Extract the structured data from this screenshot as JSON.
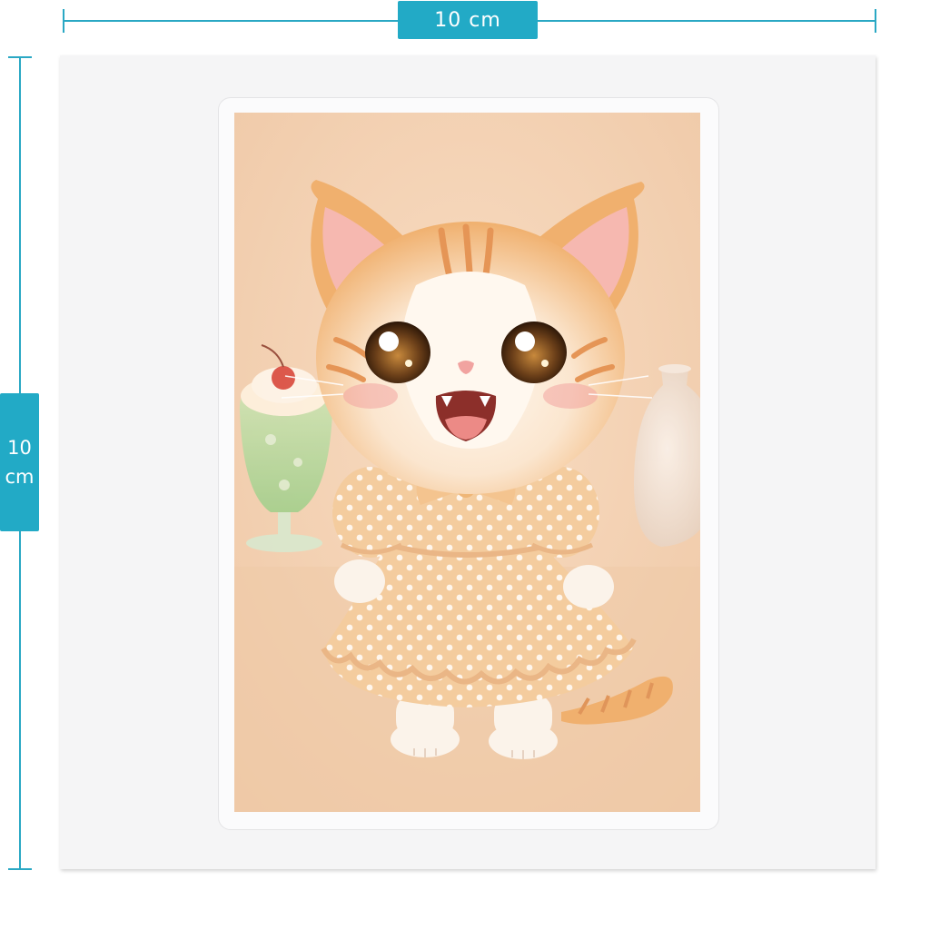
{
  "dimensions": {
    "width": {
      "value": "10",
      "unit": "cm"
    },
    "height": {
      "value": "10",
      "unit": "cm"
    }
  },
  "artwork": {
    "icon": "kitten-in-polka-dot-dress-illustration",
    "colors": {
      "background": "#f3d2b4",
      "fur_orange": "#f0b06e",
      "fur_white": "#fbf3ea",
      "dress": "#f4cc9e",
      "dots": "#fff6ec",
      "accent": "#2aa8c4"
    }
  }
}
